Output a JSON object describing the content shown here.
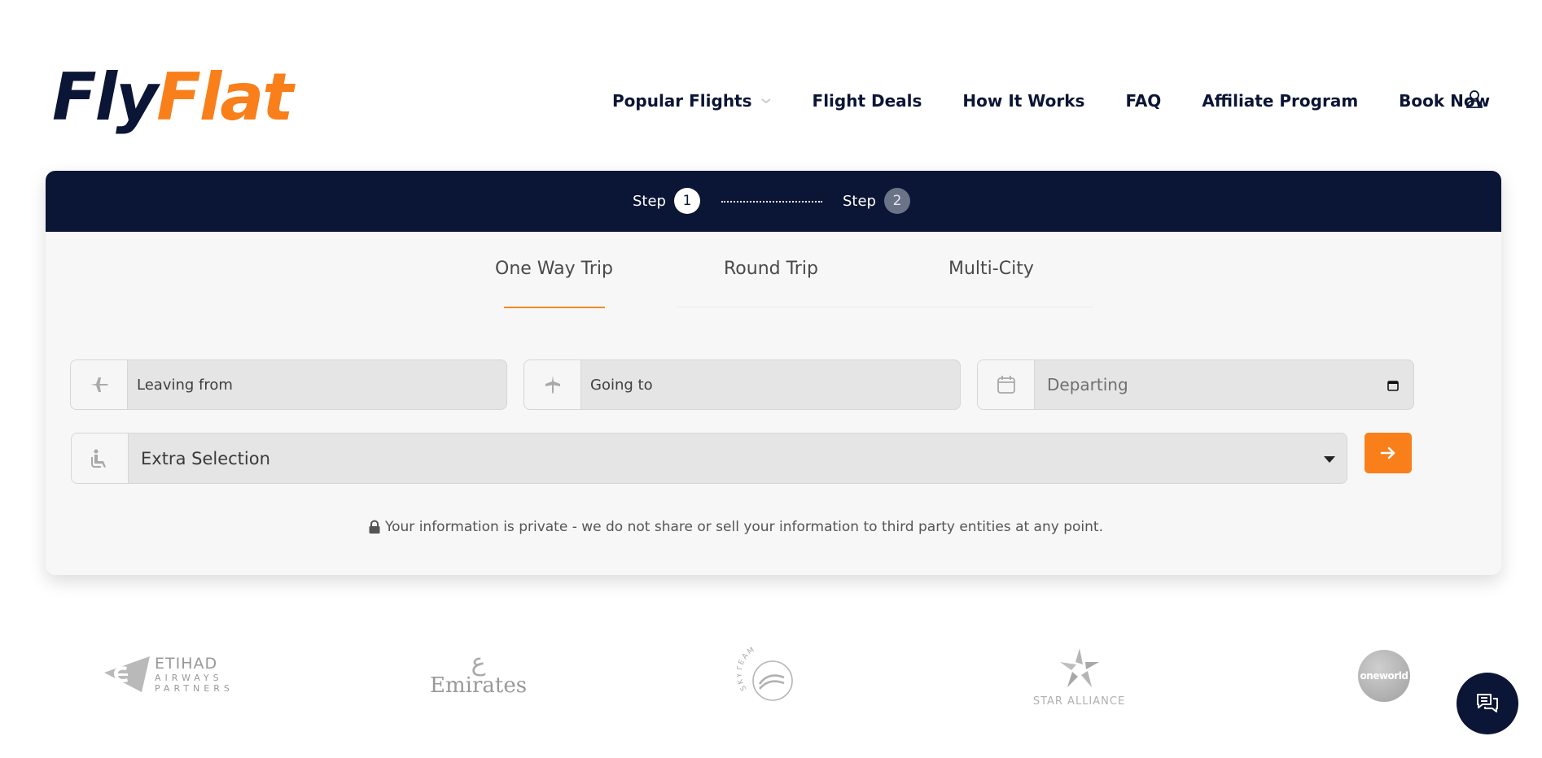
{
  "brand": {
    "logo_part1": "Fly",
    "logo_part2": "Flat",
    "primary_color": "#0b1535",
    "accent_color": "#f97f1a"
  },
  "nav": {
    "items": [
      {
        "label": "Popular Flights",
        "has_dropdown": true
      },
      {
        "label": "Flight Deals"
      },
      {
        "label": "How It Works"
      },
      {
        "label": "FAQ"
      },
      {
        "label": "Affiliate Program"
      },
      {
        "label": "Book Now"
      }
    ],
    "user_icon": "user-icon"
  },
  "steps": {
    "step1_label": "Step",
    "step1_num": "1",
    "step2_label": "Step",
    "step2_num": "2",
    "active_step": 1
  },
  "tabs": [
    {
      "label": "One Way Trip",
      "active": true
    },
    {
      "label": "Round Trip",
      "active": false
    },
    {
      "label": "Multi-City",
      "active": false
    }
  ],
  "form": {
    "leaving_from_placeholder": "Leaving from",
    "going_to_placeholder": "Going to",
    "departing_placeholder": "Departing",
    "extra_selection": "Extra Selection",
    "submit_icon": "arrow-right-icon"
  },
  "privacy_note": "Your information is private - we do not share or sell your information to third party entities at any point.",
  "partners": {
    "etihad_line1": "ETIHAD",
    "etihad_line2": "AIRWAYS",
    "etihad_line3": "PARTNERS",
    "emirates": "Emirates",
    "skyteam": "SKYTEAM",
    "star_alliance": "STAR ALLIANCE",
    "oneworld": "oneworld"
  },
  "chat_icon": "chat-icon"
}
